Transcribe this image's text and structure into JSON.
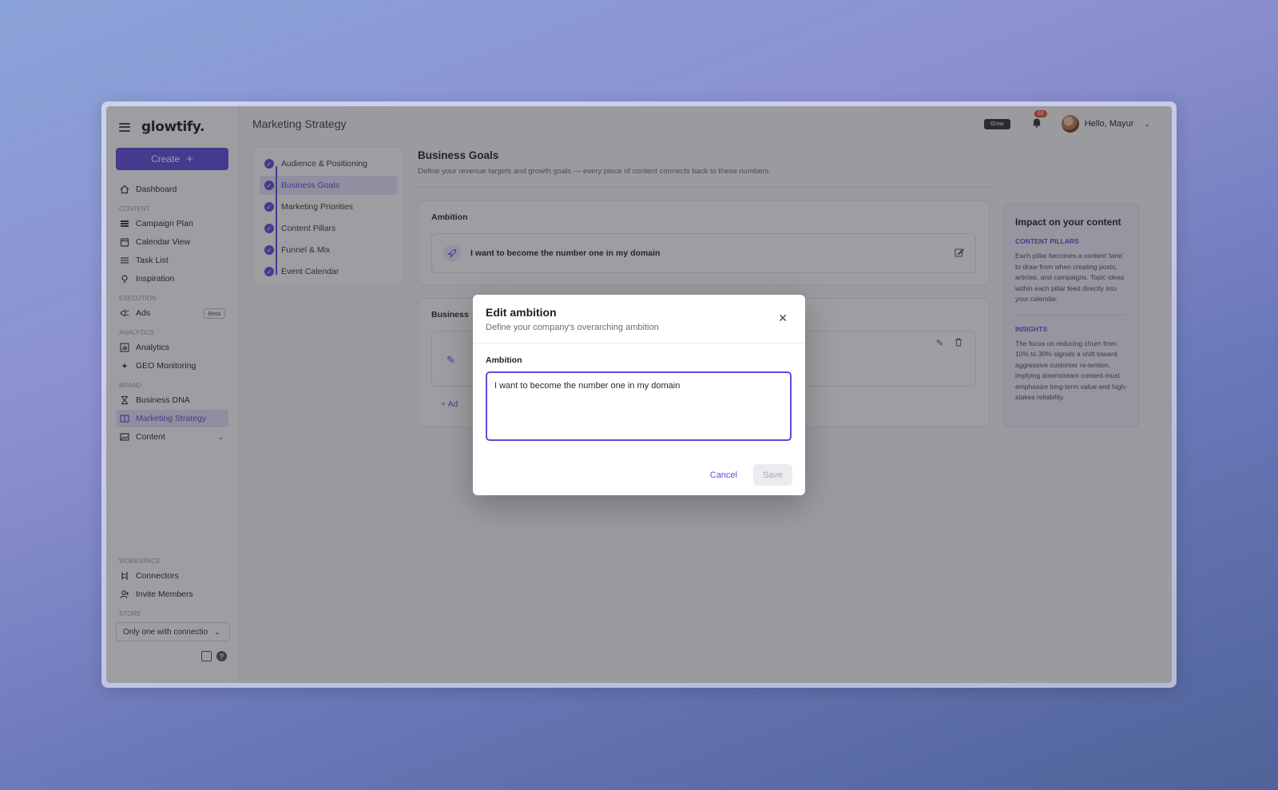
{
  "app": {
    "logo": "glowtify."
  },
  "sidebar": {
    "create_label": "Create",
    "dashboard": "Dashboard",
    "sections": {
      "content": "CONTENT",
      "execution": "EXECUTION",
      "analytics": "ANALYTICS",
      "brand": "BRAND",
      "workspace": "WORKSPACE",
      "store": "STORE"
    },
    "items": {
      "campaign_plan": "Campaign Plan",
      "calendar_view": "Calendar View",
      "task_list": "Task List",
      "inspiration": "Inspiration",
      "ads": "Ads",
      "ads_badge": "Beta",
      "analytics": "Analytics",
      "geo_monitoring": "GEO Monitoring",
      "business_dna": "Business DNA",
      "marketing_strategy": "Marketing Strategy",
      "content": "Content",
      "connectors": "Connectors",
      "invite_members": "Invite Members"
    },
    "store_value": "Only one with connectio"
  },
  "header": {
    "title": "Marketing Strategy",
    "plan_chip": "Grow",
    "notification_count": "68",
    "greeting": "Hello, Mayur"
  },
  "steps": [
    {
      "label": "Audience & Positioning"
    },
    {
      "label": "Business Goals"
    },
    {
      "label": "Marketing Priorities"
    },
    {
      "label": "Content Pillars"
    },
    {
      "label": "Funnel & Mix"
    },
    {
      "label": "Event Calendar"
    }
  ],
  "main": {
    "title": "Business Goals",
    "subtitle": "Define your revenue targets and growth goals — every piece of content connects back to these numbers.",
    "ambition_label": "Ambition",
    "ambition_text": "I want to become the number one in my domain",
    "goals_label": "Business",
    "add_label": "Ad"
  },
  "impact": {
    "title": "Impact on your content",
    "pillars_heading": "CONTENT PILLARS",
    "pillars_text": "Each pillar becomes a content 'lane' to draw from when creating posts, articles, and campaigns. Topic ideas within each pillar feed directly into your calendar.",
    "insights_heading": "INSIGHTS",
    "insights_text": "The focus on reducing churn from 10% to 30% signals a shift toward aggressive customer re-tention, implying downstream content must emphasize long-term value and high-stakes reliability."
  },
  "modal": {
    "title": "Edit ambition",
    "subtitle": "Define your company's overarching ambition",
    "field_label": "Ambition",
    "field_value": "I want to become the number one in my domain",
    "cancel_label": "Cancel",
    "save_label": "Save"
  },
  "colors": {
    "accent": "#5b4bdb",
    "overlay": "#282830"
  }
}
